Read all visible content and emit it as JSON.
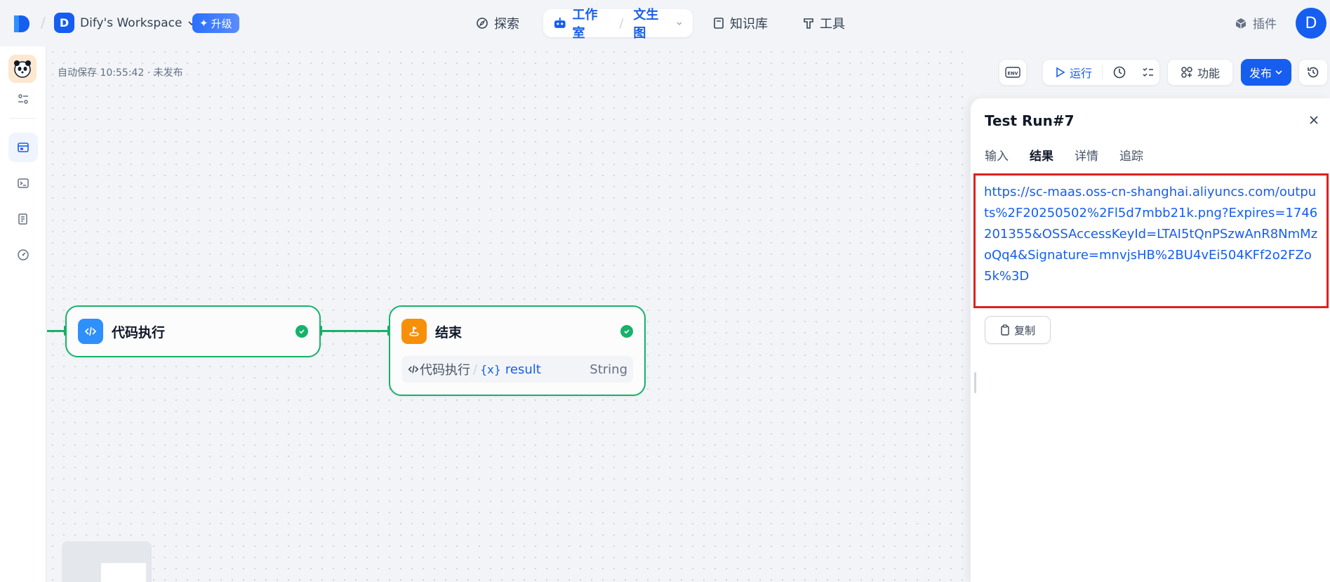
{
  "header": {
    "workspace_initial": "D",
    "workspace_name": "Dify's Workspace",
    "upgrade_label": "升级",
    "nav": {
      "explore": "探索",
      "studio": "工作室",
      "app_name": "文生图",
      "knowledge": "知识库",
      "tools": "工具"
    },
    "plugins": "插件",
    "user_initial": "D"
  },
  "canvas": {
    "autosave": "自动保存 10:55:42 · 未发布",
    "nodes": {
      "code": {
        "title": "代码执行"
      },
      "end": {
        "title": "结束",
        "var_source": "代码执行",
        "var_sep": "/",
        "var_icon": "{x}",
        "var_name": "result",
        "var_type": "String"
      }
    }
  },
  "toolbar": {
    "env": "ENV",
    "run": "运行",
    "features": "功能",
    "publish": "发布"
  },
  "panel": {
    "title": "Test Run#7",
    "tabs": [
      "输入",
      "结果",
      "详情",
      "追踪"
    ],
    "active_tab": "结果",
    "result_text": "https://sc-maas.oss-cn-shanghai.aliyuncs.com/outputs%2F20250502%2Fl5d7mbb21k.png?Expires=1746201355&OSSAccessKeyId=LTAI5tQnPSzwAnR8NmMzoQq4&Signature=mnvjsHB%2BU4vEi504KFf2o2FZo5k%3D",
    "copy_label": "复制"
  },
  "colors": {
    "accent": "#155eef",
    "success": "#17b26a",
    "highlight_border": "#e02020",
    "end_node_icon": "#f79009",
    "code_node_icon": "#2e90fa"
  }
}
